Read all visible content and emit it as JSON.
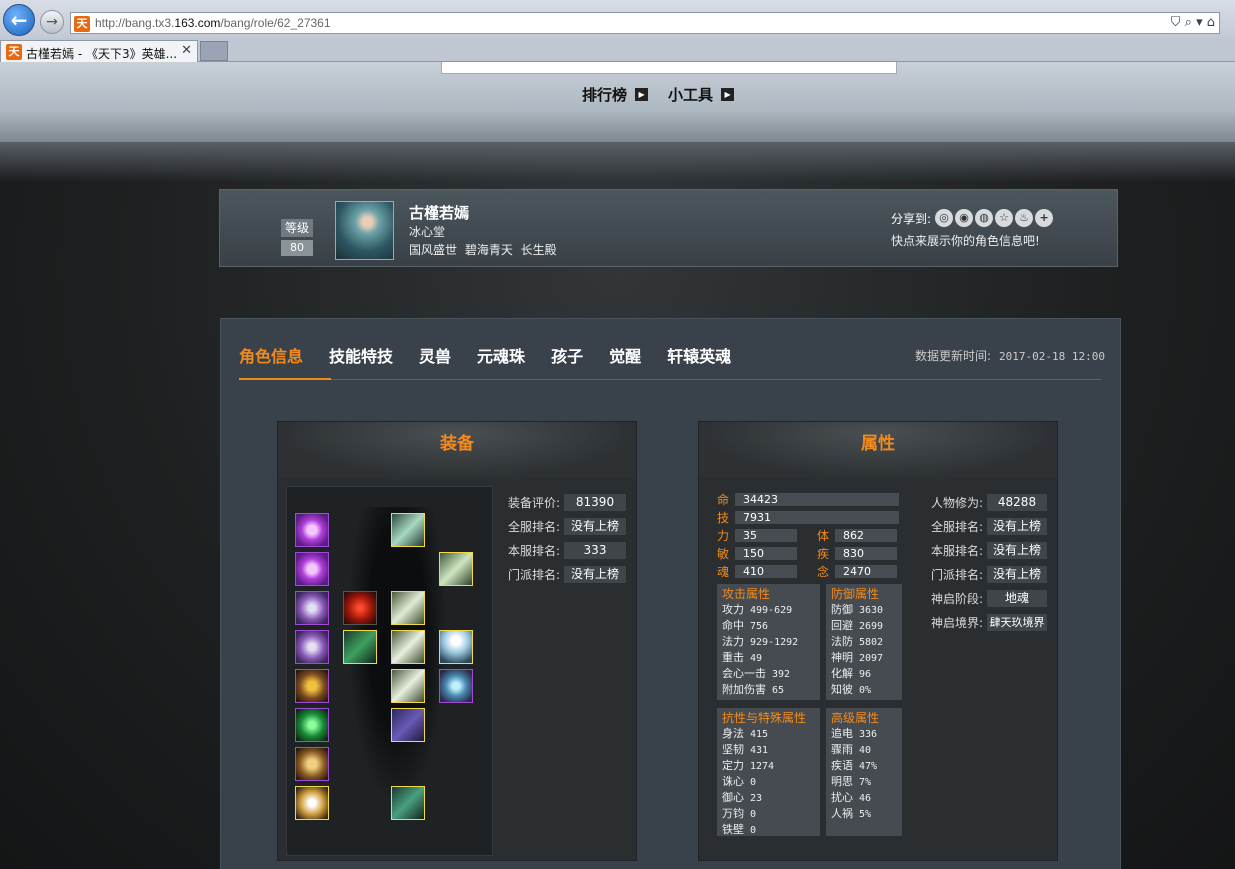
{
  "browser": {
    "url_prefix": "http://bang.tx3.",
    "url_domain": "163.com",
    "url_path": "/bang/role/62_27361",
    "favicon": "天",
    "tab_title": "古槿若嫣 - 《天下3》英雄...",
    "right_icons": "⛉ ⌕ ▾ ⌂"
  },
  "topnav": {
    "items": [
      "排行榜",
      "小工具"
    ]
  },
  "profile": {
    "level_label": "等级",
    "level_value": "80",
    "name": "古槿若嫣",
    "guild": "冰心堂",
    "server": "国风盛世 碧海青天 长生殿",
    "share_label": "分享到:",
    "share_icons": [
      "wechat-icon",
      "qq-icon",
      "weibo-icon",
      "star-icon",
      "tencent-weibo-icon",
      "plus-icon"
    ],
    "share_icon_glyphs": [
      "◎",
      "◉",
      "◍",
      "☆",
      "♨",
      "+"
    ],
    "share_tip": "快点来展示你的角色信息吧!"
  },
  "tabs": [
    "角色信息",
    "技能特技",
    "灵兽",
    "元魂珠",
    "孩子",
    "觉醒",
    "轩辕英魂"
  ],
  "update_label": "数据更新时间:",
  "update_time": "2017-02-18 12:00",
  "equipment": {
    "title": "装备",
    "stats": [
      {
        "label": "装备评价:",
        "value": "81390"
      },
      {
        "label": "全服排名:",
        "value": "没有上榜"
      },
      {
        "label": "本服排名:",
        "value": "333"
      },
      {
        "label": "门派排名:",
        "value": "没有上榜"
      }
    ]
  },
  "attributes": {
    "title": "属性",
    "main": [
      {
        "label": "命",
        "value": "34423"
      },
      {
        "label": "技",
        "value": "7931"
      }
    ],
    "pairs": [
      {
        "l1": "力",
        "v1": "35",
        "l2": "体",
        "v2": "862"
      },
      {
        "l1": "敏",
        "v1": "150",
        "l2": "疾",
        "v2": "830"
      },
      {
        "l1": "魂",
        "v1": "410",
        "l2": "念",
        "v2": "2470"
      }
    ],
    "attack": {
      "title": "攻击属性",
      "rows": [
        {
          "k": "攻力",
          "v": "499-629"
        },
        {
          "k": "命中",
          "v": "756"
        },
        {
          "k": "法力",
          "v": "929-1292"
        },
        {
          "k": "重击",
          "v": "49"
        },
        {
          "k": "会心一击",
          "v": "392"
        },
        {
          "k": "附加伤害",
          "v": "65"
        }
      ]
    },
    "defense": {
      "title": "防御属性",
      "rows": [
        {
          "k": "防御",
          "v": "3630"
        },
        {
          "k": "回避",
          "v": "2699"
        },
        {
          "k": "法防",
          "v": "5802"
        },
        {
          "k": "神明",
          "v": "2097"
        },
        {
          "k": "化解",
          "v": "96"
        },
        {
          "k": "知彼",
          "v": "0%"
        }
      ]
    },
    "resist": {
      "title": "抗性与特殊属性",
      "rows": [
        {
          "k": "身法",
          "v": "415"
        },
        {
          "k": "坚韧",
          "v": "431"
        },
        {
          "k": "定力",
          "v": "1274"
        },
        {
          "k": "诛心",
          "v": "0"
        },
        {
          "k": "御心",
          "v": "23"
        },
        {
          "k": "万钧",
          "v": "0"
        },
        {
          "k": "铁壁",
          "v": "0"
        }
      ]
    },
    "advanced": {
      "title": "高级属性",
      "rows": [
        {
          "k": "追电",
          "v": "336"
        },
        {
          "k": "骤雨",
          "v": "40"
        },
        {
          "k": "疾语",
          "v": "47%"
        },
        {
          "k": "明思",
          "v": "7%"
        },
        {
          "k": "扰心",
          "v": "46"
        },
        {
          "k": "人祸",
          "v": "5%"
        }
      ]
    },
    "right": [
      {
        "label": "人物修为:",
        "value": "48288"
      },
      {
        "label": "全服排名:",
        "value": "没有上榜"
      },
      {
        "label": "本服排名:",
        "value": "没有上榜"
      },
      {
        "label": "门派排名:",
        "value": "没有上榜"
      },
      {
        "label": "神启阶段:",
        "value": "地魂"
      },
      {
        "label": "神启境界:",
        "value": "肆天玖境界"
      }
    ]
  },
  "colors": {
    "accent": "#f38b1c",
    "panel": "#39414a",
    "card": "#2a2e31"
  }
}
